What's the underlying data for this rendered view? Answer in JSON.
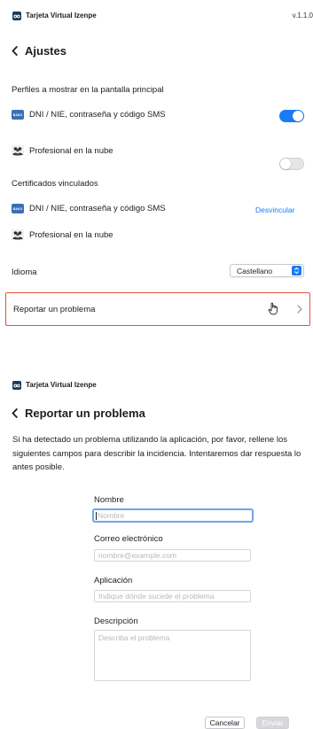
{
  "settings": {
    "app_name": "Tarjeta Virtual Izenpe",
    "version": "v.1.1.0",
    "back_title": "Ajustes",
    "profiles_section": "Perfiles a mostrar en la pantalla principal",
    "profiles": [
      {
        "label": "DNI / NIE, contraseña y código SMS",
        "icon": "bako-icon",
        "enabled": true
      },
      {
        "label": "Profesional en la nube",
        "icon": "people-icon",
        "enabled": false
      }
    ],
    "certs_section": "Certificados vinculados",
    "certs": [
      {
        "label": "DNI / NIE, contraseña y código SMS",
        "icon": "bako-icon",
        "action": "Desvincular"
      },
      {
        "label": "Profesional en la nube",
        "icon": "people-icon"
      }
    ],
    "language_label": "Idioma",
    "language_value": "Castellano",
    "report_label": "Reportar un problema"
  },
  "report": {
    "app_name": "Tarjeta Virtual Izenpe",
    "back_title": "Reportar un problema",
    "description": "Si ha detectado un problema utilizando la aplicación, por favor, rellene los siguientes campos para describir la incidencia. Intentaremos dar respuesta lo antes posible.",
    "fields": {
      "name_label": "Nombre",
      "name_placeholder": "Nombre",
      "email_label": "Correo electrónico",
      "email_placeholder": "nombre@example.com",
      "app_label": "Aplicación",
      "app_placeholder": "Indique dónde sucede el problema",
      "desc_label": "Descripción",
      "desc_placeholder": "Describa el problema"
    },
    "cancel_label": "Cancelar",
    "send_label": "Enviar"
  },
  "colors": {
    "accent": "#1a7cf5",
    "highlight_border": "#e8503a",
    "logo_bg": "#1b3a5c"
  }
}
